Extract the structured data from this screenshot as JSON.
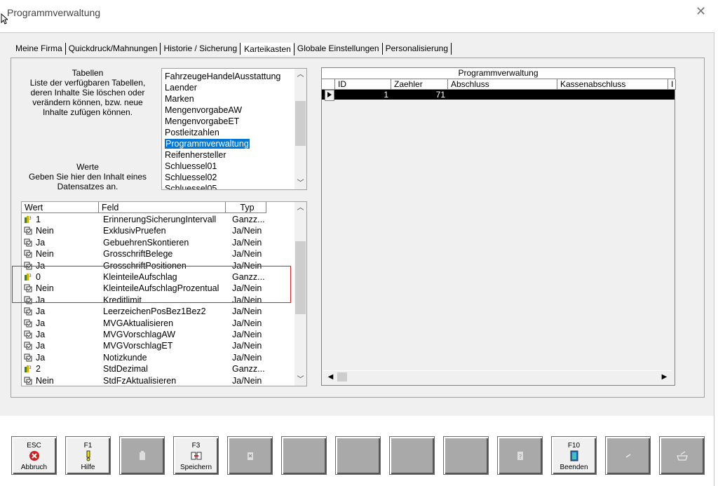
{
  "window": {
    "title": "Programmverwaltung"
  },
  "tabs": [
    {
      "label": "Meine Firma",
      "active": false
    },
    {
      "label": "Quickdruck/Mahnungen",
      "active": false
    },
    {
      "label": "Historie / Sicherung",
      "active": false
    },
    {
      "label": "Karteikasten",
      "active": true
    },
    {
      "label": "Globale Einstellungen",
      "active": false
    },
    {
      "label": "Personalisierung",
      "active": false
    }
  ],
  "left_panel": {
    "tabellen_label": "Tabellen\nListe der verfügbaren Tabellen,\nderen Inhalte Sie löschen oder\nverändern können, bzw. neue\nInhalte zufügen können.",
    "werte_label": "Werte\nGeben Sie hier den Inhalt eines\nDatensatzes an."
  },
  "table_list": {
    "items": [
      "FahrzeugeHandelAusstattung",
      "Laender",
      "Marken",
      "MengenvorgabeAW",
      "MengenvorgabeET",
      "Postleitzahlen",
      "Programmverwaltung",
      "Reifenhersteller",
      "Schluessel01",
      "Schluessel02",
      "Schluessel05"
    ],
    "selected": "Programmverwaltung"
  },
  "value_grid": {
    "headers": [
      "Wert",
      "Feld",
      "Typ"
    ],
    "rows": [
      {
        "wert": "1",
        "feld": "ErinnerungSicherungIntervall",
        "typ": "Ganzz...",
        "icon": "number-icon"
      },
      {
        "wert": "Nein",
        "feld": "ExklusivPruefen",
        "typ": "Ja/Nein",
        "icon": "boolean-icon"
      },
      {
        "wert": "Ja",
        "feld": "GebuehrenSkontieren",
        "typ": "Ja/Nein",
        "icon": "boolean-icon"
      },
      {
        "wert": "Nein",
        "feld": "GrosschriftBelege",
        "typ": "Ja/Nein",
        "icon": "boolean-icon"
      },
      {
        "wert": "Ja",
        "feld": "GrosschriftPositionen",
        "typ": "Ja/Nein",
        "icon": "boolean-icon"
      },
      {
        "wert": "0",
        "feld": "KleinteileAufschlag",
        "typ": "Ganzz...",
        "icon": "number-icon"
      },
      {
        "wert": "Nein",
        "feld": "KleinteileAufschlagProzentual",
        "typ": "Ja/Nein",
        "icon": "boolean-icon"
      },
      {
        "wert": "Ja",
        "feld": "Kreditlimit",
        "typ": "Ja/Nein",
        "icon": "boolean-icon"
      },
      {
        "wert": "Ja",
        "feld": "LeerzeichenPosBez1Bez2",
        "typ": "Ja/Nein",
        "icon": "boolean-icon"
      },
      {
        "wert": "Ja",
        "feld": "MVGAktualisieren",
        "typ": "Ja/Nein",
        "icon": "boolean-icon"
      },
      {
        "wert": "Ja",
        "feld": "MVGVorschlagAW",
        "typ": "Ja/Nein",
        "icon": "boolean-icon"
      },
      {
        "wert": "Ja",
        "feld": "MVGVorschlagET",
        "typ": "Ja/Nein",
        "icon": "boolean-icon"
      },
      {
        "wert": "Ja",
        "feld": "Notizkunde",
        "typ": "Ja/Nein",
        "icon": "boolean-icon"
      },
      {
        "wert": "2",
        "feld": "StdDezimal",
        "typ": "Ganzz...",
        "icon": "number-icon"
      },
      {
        "wert": "Nein",
        "feld": "StdFzAktualisieren",
        "typ": "Ja/Nein",
        "icon": "boolean-icon"
      }
    ]
  },
  "right_grid": {
    "title": "Programmverwaltung",
    "headers": [
      "ID",
      "Zaehler",
      "Abschluss",
      "Kassenabschluss",
      "I"
    ],
    "row": {
      "id": "1",
      "zaehler": "71",
      "abschluss": "",
      "kassenabschluss": ""
    }
  },
  "toolbar": {
    "buttons": [
      {
        "key": "ESC",
        "label": "Abbruch",
        "icon": "cancel-icon",
        "active": true
      },
      {
        "key": "F1",
        "label": "Hilfe",
        "icon": "help-icon",
        "active": true
      },
      {
        "key": "",
        "label": "",
        "icon": "paste-icon",
        "active": false
      },
      {
        "key": "F3",
        "label": "Speichern",
        "icon": "save-icon",
        "active": true
      },
      {
        "key": "",
        "label": "",
        "icon": "delete-icon",
        "active": false
      },
      {
        "key": "",
        "label": "",
        "icon": "",
        "active": false
      },
      {
        "key": "",
        "label": "",
        "icon": "",
        "active": false
      },
      {
        "key": "",
        "label": "",
        "icon": "",
        "active": false
      },
      {
        "key": "",
        "label": "",
        "icon": "",
        "active": false
      },
      {
        "key": "",
        "label": "",
        "icon": "document-icon",
        "active": false
      },
      {
        "key": "F10",
        "label": "Beenden",
        "icon": "exit-door-icon",
        "active": true
      },
      {
        "key": "",
        "label": "",
        "icon": "pen-icon",
        "active": false
      },
      {
        "key": "",
        "label": "",
        "icon": "tray-icon",
        "active": false
      }
    ]
  },
  "colors": {
    "selection": "#0078d7",
    "highlight_box": "#e02020",
    "grid_selected_row": "#000000"
  }
}
